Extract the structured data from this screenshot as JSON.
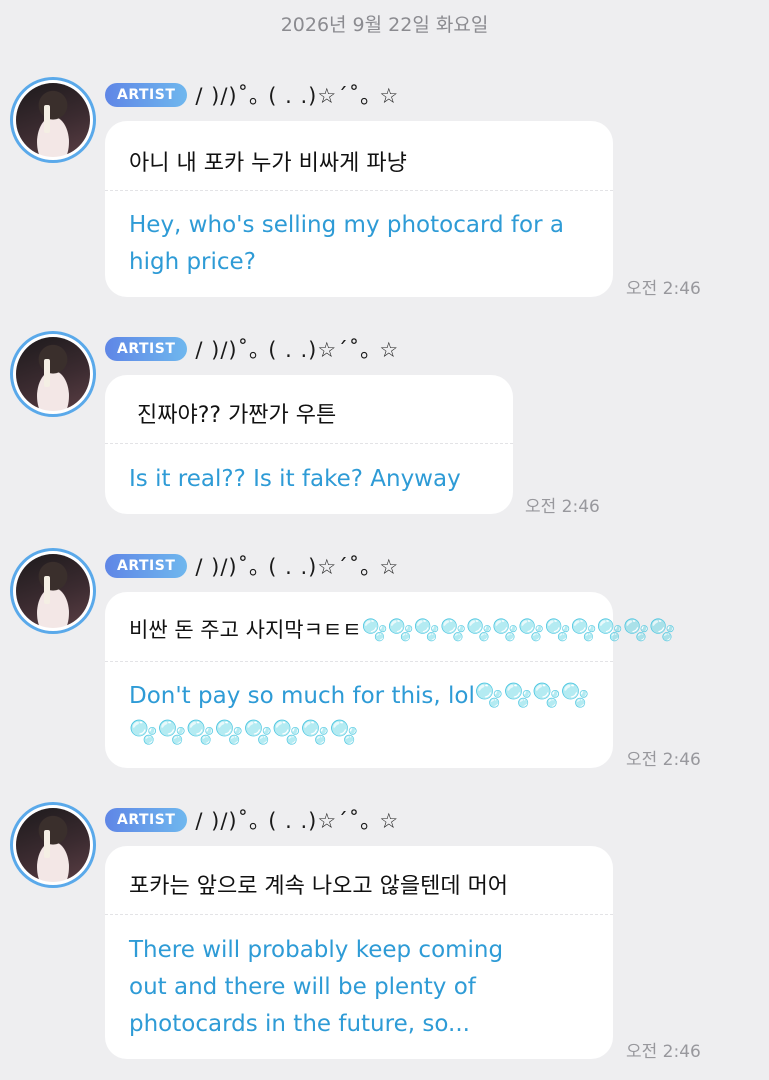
{
  "date_header": "2026년 9월 22일 화요일",
  "messages": [
    {
      "badge": "ARTIST",
      "nickname": "/ )/)˚｡ ( . .)☆´˚｡ ☆",
      "original": "아니 내 포카 누가 비싸게 파냥",
      "translation": "Hey, who's selling my photocard for a high price?",
      "time": "오전 2:46"
    },
    {
      "badge": "ARTIST",
      "nickname": "/ )/)˚｡ ( . .)☆´˚｡ ☆",
      "original": "진짜야?? 가짠가 우튼",
      "translation": "Is it real?? Is it fake? Anyway",
      "time": "오전 2:46"
    },
    {
      "badge": "ARTIST",
      "nickname": "/ )/)˚｡ ( . .)☆´˚｡ ☆",
      "original": "비싼 돈 주고 사지막ㅋㅌㅌ🫧🫧🫧🫧🫧🫧🫧🫧🫧🫧🫧🫧",
      "translation": "Don't pay so much for this, lol🫧🫧🫧🫧🫧🫧🫧🫧🫧🫧🫧🫧",
      "time": "오전 2:46"
    },
    {
      "badge": "ARTIST",
      "nickname": "/ )/)˚｡ ( . .)☆´˚｡ ☆",
      "original": "포카는 앞으로 계속 나오고 않을텐데 머어",
      "translation": "There will probably keep coming out and there will be plenty of photocards in the future, so...",
      "time": "오전 2:46"
    }
  ]
}
